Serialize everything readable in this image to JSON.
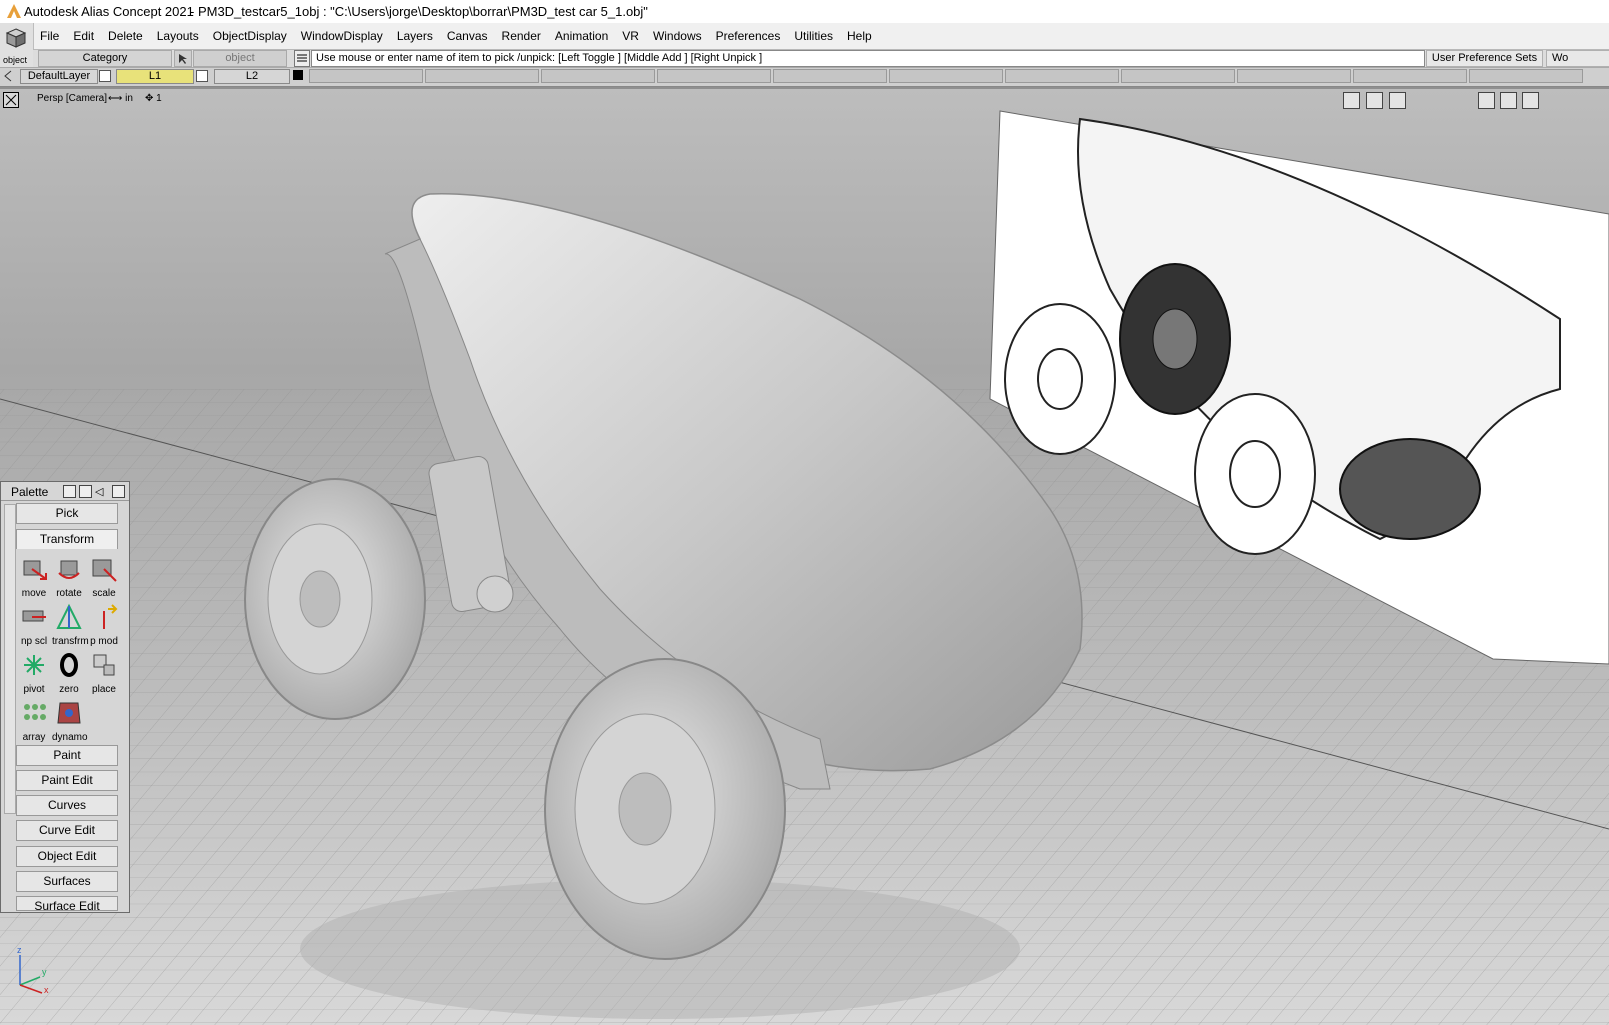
{
  "titlebar": {
    "app": "Autodesk Alias Concept 2021",
    "doc": "- PM3D_testcar5_1obj : \"C:\\Users\\jorge\\Desktop\\borrar\\PM3D_test car 5_1.obj\""
  },
  "object_button": {
    "label": "object"
  },
  "menus": [
    "File",
    "Edit",
    "Delete",
    "Layouts",
    "ObjectDisplay",
    "WindowDisplay",
    "Layers",
    "Canvas",
    "Render",
    "Animation",
    "VR",
    "Windows",
    "Preferences",
    "Utilities",
    "Help"
  ],
  "controls": {
    "category": "Category",
    "object_field": "object",
    "prompt": "Use mouse or enter name of item to pick /unpick: [Left Toggle ] [Middle Add ] [Right Unpick ]",
    "user_pref_sets": "User Preference Sets",
    "wo": "Wo"
  },
  "layers": {
    "default": "DefaultLayer",
    "l1": "L1",
    "l2": "L2",
    "l1_color": "#e8e27a"
  },
  "viewport": {
    "camera": "Persp [Camera]",
    "units": "in",
    "grid": "1"
  },
  "palette": {
    "title": "Palette",
    "pick": "Pick",
    "transform": "Transform",
    "tools": [
      {
        "label": "move",
        "icon": "move-icon"
      },
      {
        "label": "rotate",
        "icon": "rotate-icon"
      },
      {
        "label": "scale",
        "icon": "scale-icon"
      },
      {
        "label": "np scl",
        "icon": "nonprop-scale-icon"
      },
      {
        "label": "transfrm",
        "icon": "transform-icon"
      },
      {
        "label": "p mod",
        "icon": "pivot-modify-icon"
      },
      {
        "label": "pivot",
        "icon": "pivot-icon"
      },
      {
        "label": "zero",
        "icon": "zero-icon"
      },
      {
        "label": "place",
        "icon": "place-icon"
      },
      {
        "label": "array",
        "icon": "array-icon"
      },
      {
        "label": "dynamo",
        "icon": "dynamo-icon"
      }
    ],
    "sections": [
      "Paint",
      "Paint Edit",
      "Curves",
      "Curve Edit",
      "Object Edit",
      "Surfaces",
      "Surface Edit"
    ]
  },
  "axes": {
    "z": "z",
    "y": "y",
    "x": "x"
  }
}
